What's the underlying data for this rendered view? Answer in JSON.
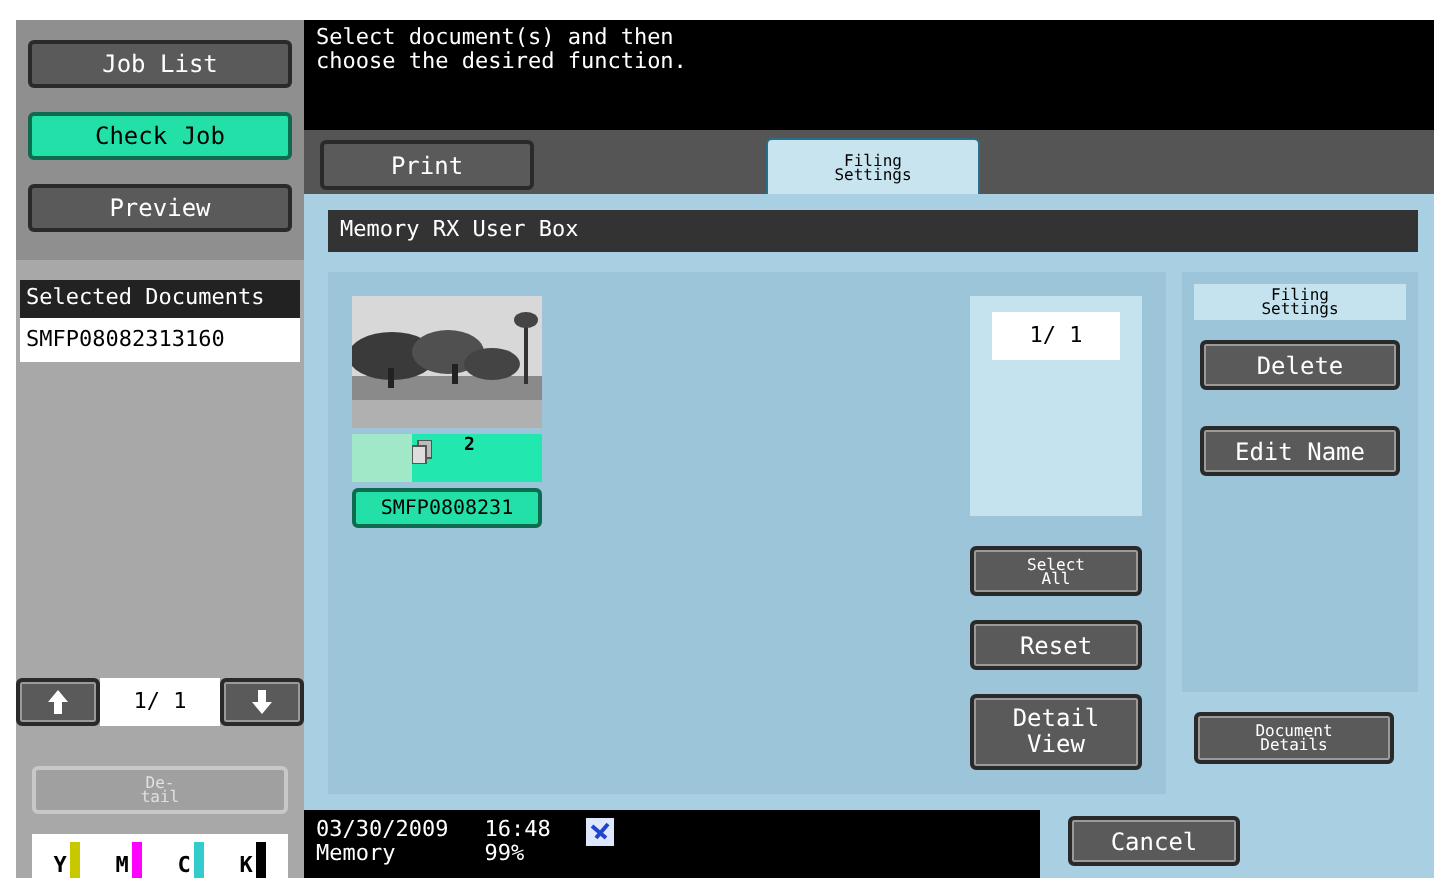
{
  "instruction": [
    "Select document(s) and then",
    "choose the desired function."
  ],
  "side_buttons": [
    {
      "label": "Job List",
      "selected": false
    },
    {
      "label": "Check Job",
      "selected": true
    },
    {
      "label": "Preview",
      "selected": false
    }
  ],
  "selected_documents": {
    "title": "Selected Documents",
    "items": [
      "SMFP08082313160"
    ]
  },
  "left_page": "1/ 1",
  "detail_button": {
    "label": "De-\ntail",
    "disabled": true
  },
  "toner": [
    {
      "label": "Y",
      "color": "#c8c800"
    },
    {
      "label": "M",
      "color": "#ff00ff"
    },
    {
      "label": "C",
      "color": "#33cccc"
    },
    {
      "label": "K",
      "color": "#000000"
    }
  ],
  "tabs": [
    {
      "label": "Print",
      "selected": false
    },
    {
      "label": "Filing\nSettings",
      "selected": true
    }
  ],
  "box_title": "Memory RX User Box",
  "documents": [
    {
      "name": "SMFP0808231",
      "pages": "2",
      "selected": true,
      "kind": "picture"
    }
  ],
  "page_counter": "1/ 1",
  "actions": [
    "Select\nAll",
    "Reset",
    "Detail\nView"
  ],
  "filing": {
    "title": "Filing\nSettings",
    "buttons": [
      "Delete",
      "Edit Name"
    ]
  },
  "document_details": "Document\nDetails",
  "status": {
    "date": "03/30/2009",
    "time": "16:48",
    "memory_label": "Memory",
    "memory_value": "99%"
  },
  "cancel": "Cancel"
}
